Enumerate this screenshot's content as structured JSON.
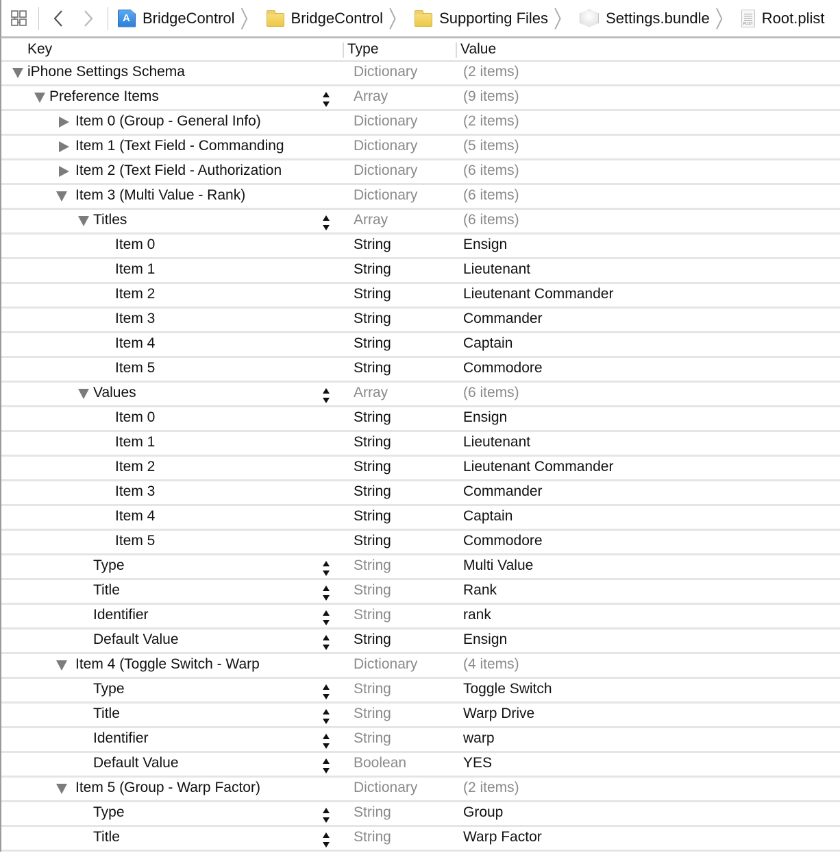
{
  "jumpbar": {
    "breadcrumbs": [
      {
        "label": "BridgeControl",
        "icon": "xcode-project-icon"
      },
      {
        "label": "BridgeControl",
        "icon": "folder-icon"
      },
      {
        "label": "Supporting Files",
        "icon": "folder-icon"
      },
      {
        "label": "Settings.bundle",
        "icon": "settings-bundle-icon"
      },
      {
        "label": "Root.plist",
        "icon": "plist-file-icon"
      }
    ]
  },
  "table": {
    "headers": {
      "key": "Key",
      "type": "Type",
      "value": "Value"
    },
    "rows": [
      {
        "key": "iPhone Settings Schema",
        "type": "Dictionary",
        "value": "(2 items)",
        "level": 0,
        "disclosure": "open",
        "stepper": false,
        "type_dark": false,
        "value_muted": true
      },
      {
        "key": "Preference Items",
        "type": "Array",
        "value": "(9 items)",
        "level": 1,
        "disclosure": "open",
        "stepper": true,
        "type_dark": false,
        "value_muted": true
      },
      {
        "key": "Item 0 (Group - General Info)",
        "type": "Dictionary",
        "value": "(2 items)",
        "level": 2,
        "disclosure": "closed",
        "stepper": false,
        "type_dark": false,
        "value_muted": true
      },
      {
        "key": "Item 1 (Text Field - Commanding",
        "type": "Dictionary",
        "value": "(5 items)",
        "level": 2,
        "disclosure": "closed",
        "stepper": false,
        "type_dark": false,
        "value_muted": true
      },
      {
        "key": "Item 2 (Text Field - Authorization",
        "type": "Dictionary",
        "value": "(6 items)",
        "level": 2,
        "disclosure": "closed",
        "stepper": false,
        "type_dark": false,
        "value_muted": true
      },
      {
        "key": "Item 3 (Multi Value - Rank)",
        "type": "Dictionary",
        "value": "(6 items)",
        "level": 2,
        "disclosure": "open",
        "stepper": false,
        "type_dark": false,
        "value_muted": true
      },
      {
        "key": "Titles",
        "type": "Array",
        "value": "(6 items)",
        "level": 3,
        "disclosure": "open",
        "stepper": true,
        "type_dark": false,
        "value_muted": true
      },
      {
        "key": "Item 0",
        "type": "String",
        "value": "Ensign",
        "level": 4,
        "disclosure": "none",
        "stepper": false,
        "type_dark": true,
        "value_muted": false
      },
      {
        "key": "Item 1",
        "type": "String",
        "value": "Lieutenant",
        "level": 4,
        "disclosure": "none",
        "stepper": false,
        "type_dark": true,
        "value_muted": false
      },
      {
        "key": "Item 2",
        "type": "String",
        "value": "Lieutenant Commander",
        "level": 4,
        "disclosure": "none",
        "stepper": false,
        "type_dark": true,
        "value_muted": false
      },
      {
        "key": "Item 3",
        "type": "String",
        "value": "Commander",
        "level": 4,
        "disclosure": "none",
        "stepper": false,
        "type_dark": true,
        "value_muted": false
      },
      {
        "key": "Item 4",
        "type": "String",
        "value": "Captain",
        "level": 4,
        "disclosure": "none",
        "stepper": false,
        "type_dark": true,
        "value_muted": false
      },
      {
        "key": "Item 5",
        "type": "String",
        "value": "Commodore",
        "level": 4,
        "disclosure": "none",
        "stepper": false,
        "type_dark": true,
        "value_muted": false
      },
      {
        "key": "Values",
        "type": "Array",
        "value": "(6 items)",
        "level": 3,
        "disclosure": "open",
        "stepper": true,
        "type_dark": false,
        "value_muted": true
      },
      {
        "key": "Item 0",
        "type": "String",
        "value": "Ensign",
        "level": 4,
        "disclosure": "none",
        "stepper": false,
        "type_dark": true,
        "value_muted": false
      },
      {
        "key": "Item 1",
        "type": "String",
        "value": "Lieutenant",
        "level": 4,
        "disclosure": "none",
        "stepper": false,
        "type_dark": true,
        "value_muted": false
      },
      {
        "key": "Item 2",
        "type": "String",
        "value": "Lieutenant Commander",
        "level": 4,
        "disclosure": "none",
        "stepper": false,
        "type_dark": true,
        "value_muted": false
      },
      {
        "key": "Item 3",
        "type": "String",
        "value": "Commander",
        "level": 4,
        "disclosure": "none",
        "stepper": false,
        "type_dark": true,
        "value_muted": false
      },
      {
        "key": "Item 4",
        "type": "String",
        "value": "Captain",
        "level": 4,
        "disclosure": "none",
        "stepper": false,
        "type_dark": true,
        "value_muted": false
      },
      {
        "key": "Item 5",
        "type": "String",
        "value": "Commodore",
        "level": 4,
        "disclosure": "none",
        "stepper": false,
        "type_dark": true,
        "value_muted": false
      },
      {
        "key": "Type",
        "type": "String",
        "value": "Multi Value",
        "level": 3,
        "disclosure": "none",
        "stepper": true,
        "type_dark": false,
        "value_muted": false
      },
      {
        "key": "Title",
        "type": "String",
        "value": "Rank",
        "level": 3,
        "disclosure": "none",
        "stepper": true,
        "type_dark": false,
        "value_muted": false
      },
      {
        "key": "Identifier",
        "type": "String",
        "value": "rank",
        "level": 3,
        "disclosure": "none",
        "stepper": true,
        "type_dark": false,
        "value_muted": false
      },
      {
        "key": "Default Value",
        "type": "String",
        "value": "Ensign",
        "level": 3,
        "disclosure": "none",
        "stepper": true,
        "type_dark": true,
        "value_muted": false
      },
      {
        "key": "Item 4 (Toggle Switch - Warp",
        "type": "Dictionary",
        "value": "(4 items)",
        "level": 2,
        "disclosure": "open",
        "stepper": false,
        "type_dark": false,
        "value_muted": true
      },
      {
        "key": "Type",
        "type": "String",
        "value": "Toggle Switch",
        "level": 3,
        "disclosure": "none",
        "stepper": true,
        "type_dark": false,
        "value_muted": false
      },
      {
        "key": "Title",
        "type": "String",
        "value": "Warp Drive",
        "level": 3,
        "disclosure": "none",
        "stepper": true,
        "type_dark": false,
        "value_muted": false
      },
      {
        "key": "Identifier",
        "type": "String",
        "value": "warp",
        "level": 3,
        "disclosure": "none",
        "stepper": true,
        "type_dark": false,
        "value_muted": false
      },
      {
        "key": "Default Value",
        "type": "Boolean",
        "value": "YES",
        "level": 3,
        "disclosure": "none",
        "stepper": true,
        "type_dark": false,
        "value_muted": false
      },
      {
        "key": "Item 5 (Group - Warp Factor)",
        "type": "Dictionary",
        "value": "(2 items)",
        "level": 2,
        "disclosure": "open",
        "stepper": false,
        "type_dark": false,
        "value_muted": true
      },
      {
        "key": "Type",
        "type": "String",
        "value": "Group",
        "level": 3,
        "disclosure": "none",
        "stepper": true,
        "type_dark": false,
        "value_muted": false
      },
      {
        "key": "Title",
        "type": "String",
        "value": "Warp Factor",
        "level": 3,
        "disclosure": "none",
        "stepper": true,
        "type_dark": false,
        "value_muted": false
      }
    ]
  }
}
